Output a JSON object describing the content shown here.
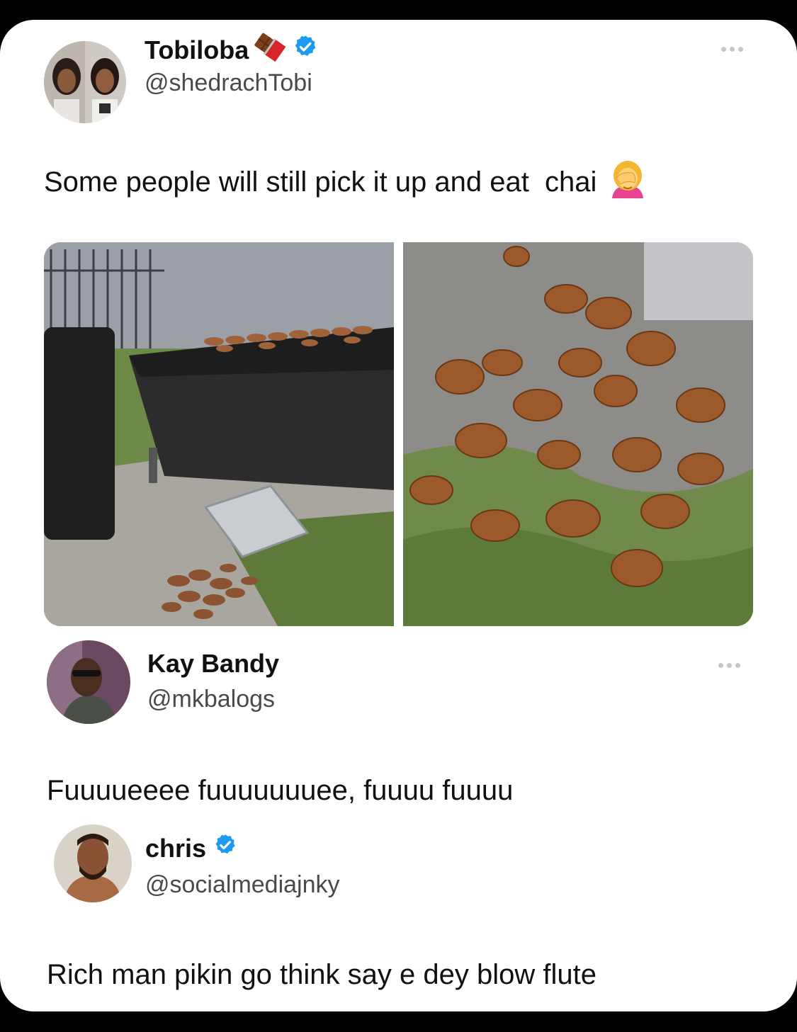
{
  "tweet": {
    "author_name": "Tobiloba",
    "author_handle": "@shedrachTobi",
    "verified": true,
    "name_emoji_icon": "chocolate-bar-icon",
    "text": "Some people will still pick it up and eat  chai",
    "text_emoji_icon": "person-facepalming-icon",
    "more_icon": "more-options-icon",
    "images": [
      "grill-with-spilled-wings-photo",
      "wings-on-grass-photo"
    ]
  },
  "reply1": {
    "author_name": "Kay Bandy",
    "author_handle": "@mkbalogs",
    "verified": false,
    "text": "Fuuuueeee fuuuuuuuee, fuuuu fuuuu",
    "more_icon": "more-options-icon"
  },
  "reply2": {
    "author_name": "chris",
    "author_handle": "@socialmediajnky",
    "verified": true,
    "text": "Rich man pikin go think say e dey blow flute"
  },
  "colors": {
    "background": "#000000",
    "card": "#ffffff",
    "verified_badge": "#1d9bf0",
    "handle_text": "#4a4a4a"
  }
}
